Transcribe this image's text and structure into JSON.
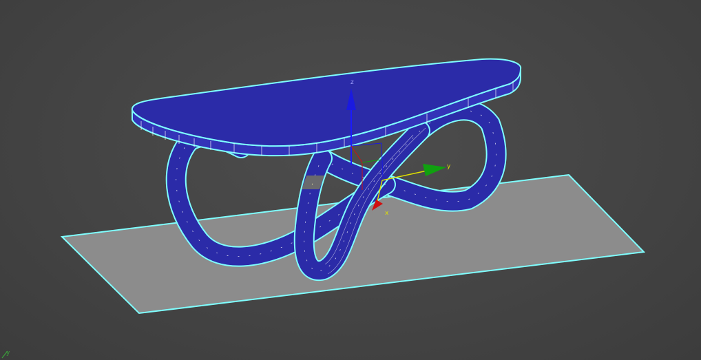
{
  "viewport": {
    "background_color": "#444444",
    "selection_color": "#7fffff",
    "object_color": "#2b2ba8",
    "ground_plane_color": "#8c8c8c",
    "wireframe_color": "#ffffff"
  },
  "scene": {
    "objects": [
      {
        "name": "table-top",
        "type": "rounded slab"
      },
      {
        "name": "figure-eight-base",
        "type": "tube loop"
      },
      {
        "name": "ground-plane",
        "type": "plane"
      }
    ]
  },
  "gizmo": {
    "x_label": "x",
    "y_label": "y",
    "z_label": "z",
    "x_color": "#d01010",
    "y_color": "#10a010",
    "z_color": "#1010d0"
  },
  "corner_axes": {
    "label": "y",
    "color": "#3aa03a"
  }
}
